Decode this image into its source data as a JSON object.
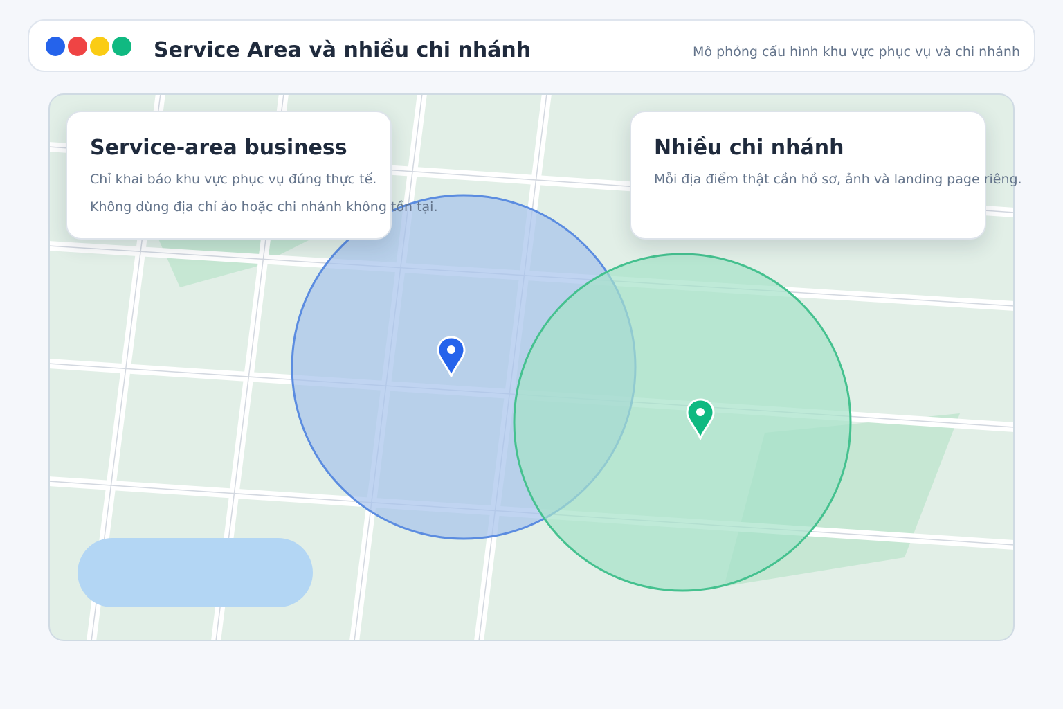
{
  "app": {
    "title": "Service Area và nhiều chi nhánh",
    "subtitle": "Mô phỏng cấu hình khu vực phục vụ và chi nhánh",
    "window_dots": [
      "#2563eb",
      "#ef4444",
      "#facc15",
      "#10b981"
    ]
  },
  "cards": {
    "service_area": {
      "title": "Service-area business",
      "lines": [
        "Chỉ khai báo khu vực phục vụ đúng thực tế.",
        "Không dùng địa chỉ ảo hoặc chi nhánh không tồn tại."
      ]
    },
    "branches": {
      "title": "Nhiều chi nhánh",
      "lines": [
        "Mỗi địa điểm thật cần hồ sơ, ảnh và landing page riêng."
      ]
    }
  },
  "map": {
    "icons": {
      "blue_pin": "map-pin-icon",
      "green_pin": "map-pin-icon"
    },
    "colors": {
      "map_bg": "#e2efe7",
      "park": "#c6e7d3",
      "road": "#ffffff",
      "service_area_fill": "#a7c4ec",
      "service_area_stroke": "#5b8ce0",
      "branch_area_fill": "#a6e2c9",
      "branch_area_stroke": "#45c18f",
      "blue_pin": "#2563eb",
      "green_pin": "#10b981",
      "bottom_pill": "#b3d6f4"
    }
  }
}
